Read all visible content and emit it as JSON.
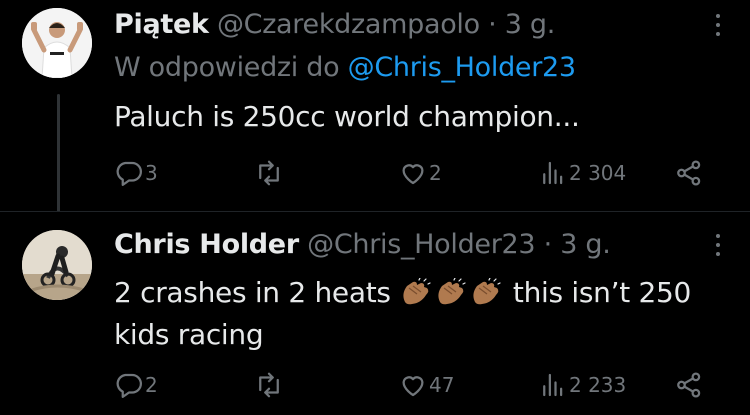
{
  "tweets": [
    {
      "display_name": "Piątek",
      "handle": "@Czarekdzampaolo",
      "separator": "·",
      "time": "3 g.",
      "reply_prefix": "W odpowiedzi do",
      "reply_handle": "@Chris_Holder23",
      "text": "Paluch is 250cc world champion...",
      "replies": "3",
      "retweets": "",
      "likes": "2",
      "views": "2 304"
    },
    {
      "display_name": "Chris Holder",
      "handle": "@Chris_Holder23",
      "separator": "·",
      "time": "3 g.",
      "text_part1": "2 crashes in 2 heats",
      "text_part2": " this isn’t 250 kids racing",
      "replies": "2",
      "retweets": "",
      "likes": "47",
      "views": "2 233"
    }
  ],
  "icons": [
    "more-icon",
    "reply-icon",
    "retweet-icon",
    "like-icon",
    "views-icon",
    "share-icon",
    "clapping-hands-emoji"
  ],
  "colors": {
    "background": "#000000",
    "text": "#e7e9ea",
    "muted": "#71767b",
    "link": "#1d9bf0"
  }
}
